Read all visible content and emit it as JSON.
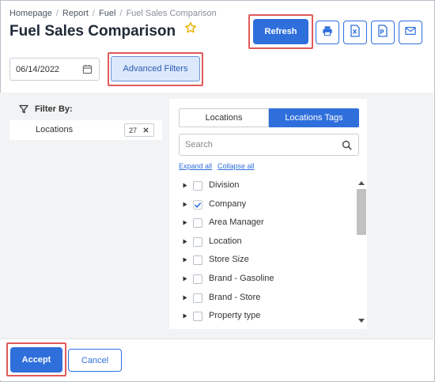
{
  "breadcrumb": {
    "items": [
      "Homepage",
      "Report",
      "Fuel"
    ],
    "current": "Fuel Sales Comparison"
  },
  "page": {
    "title": "Fuel Sales Comparison",
    "favorite_icon": "star-outline-icon"
  },
  "toolbar": {
    "refresh_label": "Refresh",
    "icons": [
      "print-icon",
      "excel-icon",
      "pdf-icon",
      "email-icon"
    ],
    "accent_color": "#2f6fdc"
  },
  "filters": {
    "date_value": "06/14/2022",
    "advanced_label": "Advanced Filters"
  },
  "filter_by": {
    "heading": "Filter By:",
    "items": [
      {
        "label": "Locations",
        "count": "27"
      }
    ]
  },
  "locations_panel": {
    "tabs": [
      {
        "label": "Locations",
        "active": false
      },
      {
        "label": "Locations Tags",
        "active": true
      }
    ],
    "search_placeholder": "Search",
    "expand_all": "Expand all",
    "collapse_all": "Collapse all",
    "tree": [
      {
        "label": "Division",
        "checked": false
      },
      {
        "label": "Company",
        "checked": true
      },
      {
        "label": "Area Manager",
        "checked": false
      },
      {
        "label": "Location",
        "checked": false
      },
      {
        "label": "Store Size",
        "checked": false
      },
      {
        "label": "Brand - Gasoline",
        "checked": false
      },
      {
        "label": "Brand - Store",
        "checked": false
      },
      {
        "label": "Property type",
        "checked": false
      }
    ]
  },
  "footer": {
    "accept_label": "Accept",
    "cancel_label": "Cancel"
  },
  "highlight_color": "#e05a5a"
}
